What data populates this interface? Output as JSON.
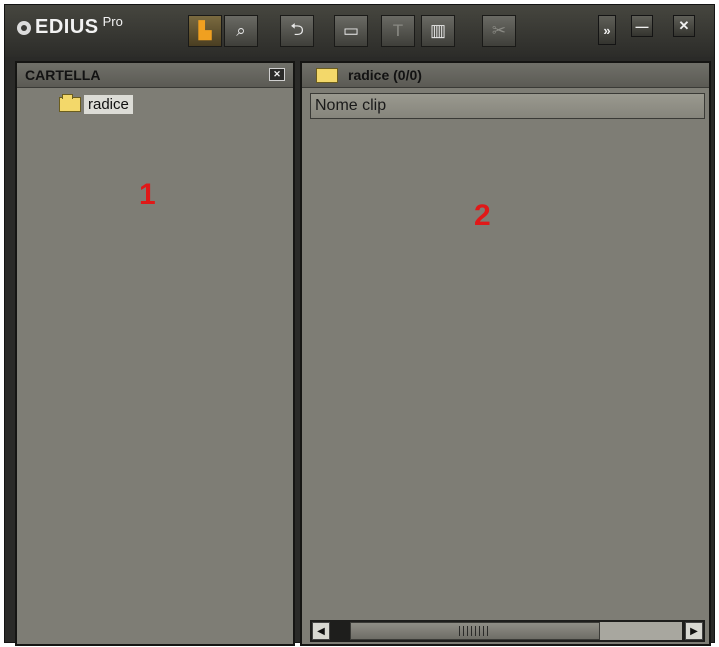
{
  "app": {
    "brand": "EDIUS",
    "brand_suffix": "Pro"
  },
  "toolbar": {
    "buttons": [
      {
        "icon": "folder-view-icon",
        "state": "active"
      },
      {
        "icon": "search-clip-icon",
        "state": "normal"
      },
      {
        "icon": "up-level-icon",
        "state": "normal"
      },
      {
        "icon": "open-folder-icon",
        "state": "normal"
      },
      {
        "icon": "title-icon",
        "glyph": "T",
        "state": "disabled"
      },
      {
        "icon": "view-mode-icon",
        "state": "normal"
      },
      {
        "icon": "cut-icon",
        "state": "disabled"
      }
    ]
  },
  "folder_panel": {
    "title": "CARTELLA",
    "tree": [
      {
        "label": "radice",
        "selected": true
      }
    ],
    "annotation": "1"
  },
  "clip_panel": {
    "title": "radice (0/0)",
    "column_header": "Nome clip",
    "annotation": "2",
    "scroll_grip": "||||||"
  },
  "colors": {
    "panel_bg": "#7e7d75",
    "frame": "#2a2a28",
    "annotation": "#e01818",
    "folder": "#f3d86a"
  }
}
